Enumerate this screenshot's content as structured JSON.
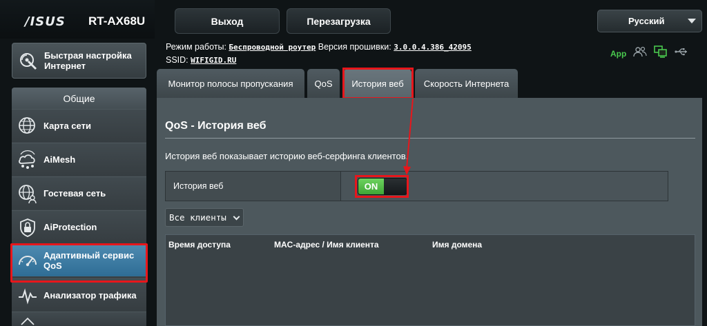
{
  "header": {
    "brand": "/ISUS",
    "model": "RT-AX68U",
    "logout_label": "Выход",
    "reboot_label": "Перезагрузка",
    "language": "Русский"
  },
  "info": {
    "mode_label": "Режим работы:",
    "mode_value": "Беспроводной роутер",
    "firmware_label": "Версия прошивки:",
    "firmware_value": "3.0.0.4.386_42095",
    "ssid_label": "SSID:",
    "ssid_value": "WIFIGID.RU"
  },
  "status": {
    "app_label": "App",
    "app_color": "#49c94e"
  },
  "sidebar": {
    "quick_setup_label": "Быстрая настройка Интернет",
    "section_header": "Общие",
    "items": [
      {
        "label": "Карта сети",
        "icon": "globe-icon"
      },
      {
        "label": "AiMesh",
        "icon": "aimesh-icon"
      },
      {
        "label": "Гостевая сеть",
        "icon": "guest-network-icon"
      },
      {
        "label": "AiProtection",
        "icon": "lock-shield-icon"
      },
      {
        "label": "Адаптивный сервис QoS",
        "icon": "speedometer-icon"
      },
      {
        "label": "Анализатор трафика",
        "icon": "traffic-analyzer-icon"
      }
    ],
    "selected_color": "#3b7ca6"
  },
  "tabs": [
    {
      "label": "Монитор полосы пропускания"
    },
    {
      "label": "QoS"
    },
    {
      "label": "История веб"
    },
    {
      "label": "Скорость Интернета"
    }
  ],
  "panel": {
    "title": "QoS - История веб",
    "description": "История веб показывает историю веб-серфинга клиентов.",
    "setting_label": "История веб",
    "toggle_label": "ON",
    "toggle_color": "#4cb842",
    "client_select": "Все клиенты",
    "columns": [
      "Время доступа",
      "MAC-адрес / Имя клиента",
      "Имя домена"
    ]
  },
  "annotation_color": "#e8161b"
}
